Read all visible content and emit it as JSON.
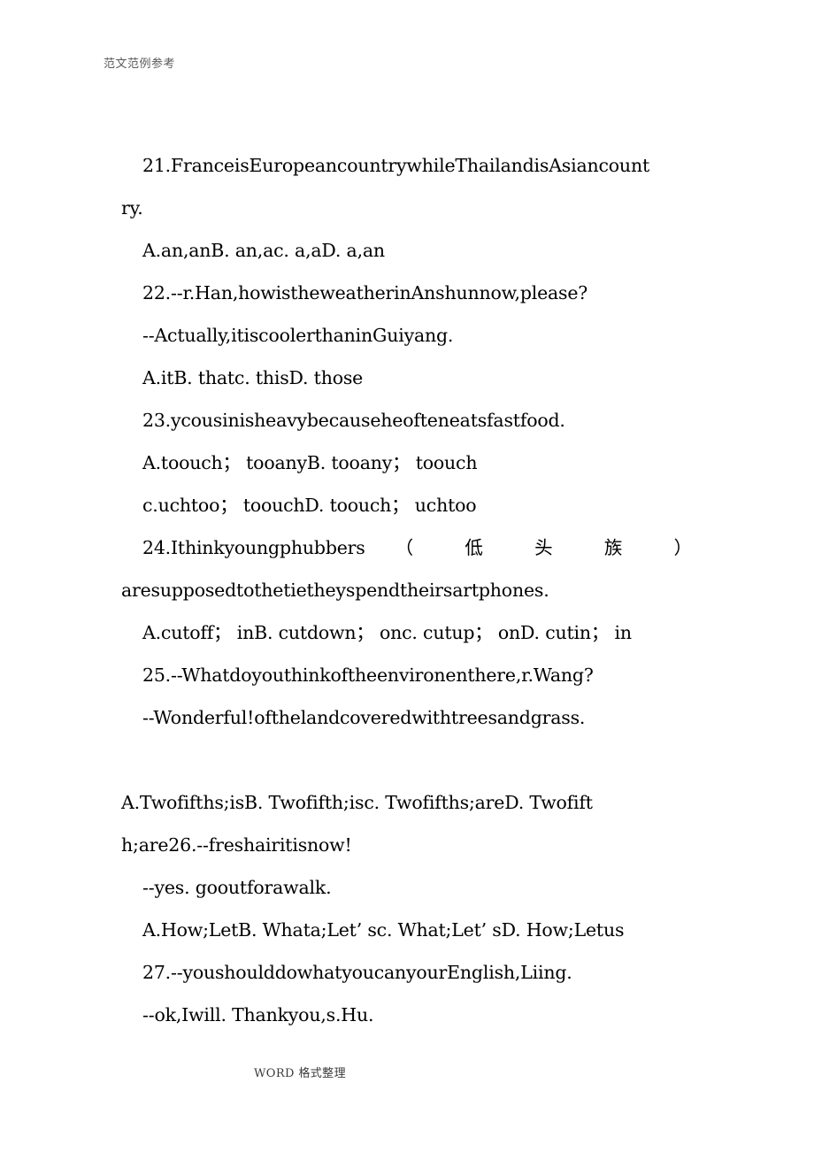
{
  "document": {
    "header": "范文范例参考",
    "footer": "WORD 格式整理"
  },
  "body": {
    "lines": [
      {
        "id": "q21-stem-1",
        "text": "21.FranceisEuropeancountrywhileThailandisAsiancount",
        "indent": true
      },
      {
        "id": "q21-stem-2",
        "text": "ry.",
        "indent": false
      },
      {
        "id": "q21-options",
        "text": "A.an,anB. an,ac. a,aD. a,an",
        "indent": true
      },
      {
        "id": "q22-stem",
        "text": "22.--r.Han,howistheweatherinAnshunnow,please?",
        "indent": true
      },
      {
        "id": "q22-reply",
        "text": "--Actually,itiscoolerthaninGuiyang.",
        "indent": true
      },
      {
        "id": "q22-options",
        "text": "A.itB. thatc. thisD. those",
        "indent": true
      },
      {
        "id": "q23-stem",
        "text": "23.ycousinisheavybecauseheofteneatsfastfood.",
        "indent": true
      },
      {
        "id": "q23-options-1",
        "text": "A.toouch； tooanyB. tooany； toouch",
        "indent": true
      },
      {
        "id": "q23-options-2",
        "text": "c.uchtoo； toouchD. toouch； uchtoo",
        "indent": true
      }
    ],
    "q24": {
      "id": "q24-stem-1",
      "latin": "24.Ithinkyoungphubbers",
      "cjk": [
        "（",
        "低",
        "头",
        "族",
        "）"
      ]
    },
    "lines_after": [
      {
        "id": "q24-stem-2",
        "text": "aresupposedtothetietheyspendtheirsartphones.",
        "indent": false
      },
      {
        "id": "q24-options",
        "text": "A.cutoff； inB. cutdown； onc. cutup； onD. cutin； in",
        "indent": true
      },
      {
        "id": "q25-stem",
        "text": "25.--Whatdoyouthinkoftheenvironenthere,r.Wang?",
        "indent": true
      },
      {
        "id": "q25-reply",
        "text": "--Wonderful!ofthelandcoveredwithtreesandgrass.",
        "indent": true
      },
      {
        "id": "spacer-1",
        "text": "",
        "indent": false,
        "blank": true
      },
      {
        "id": "q25-options-1",
        "text": "A.Twofifths;isB. Twofifth;isc. Twofifths;areD. Twofift",
        "indent": false
      },
      {
        "id": "q25-options-2",
        "text": "h;are26.--freshairitisnow!",
        "indent": false
      },
      {
        "id": "q26-reply",
        "text": "--yes. gooutforawalk.",
        "indent": true
      },
      {
        "id": "q26-options",
        "text": "A.How;LetB. Whata;Let’ sc. What;Let’ sD. How;Letus",
        "indent": true
      },
      {
        "id": "q27-stem",
        "text": "27.--youshoulddowhatyoucanyourEnglish,Liing.",
        "indent": true
      },
      {
        "id": "q27-reply",
        "text": "--ok,Iwill. Thankyou,s.Hu.",
        "indent": true
      }
    ]
  }
}
